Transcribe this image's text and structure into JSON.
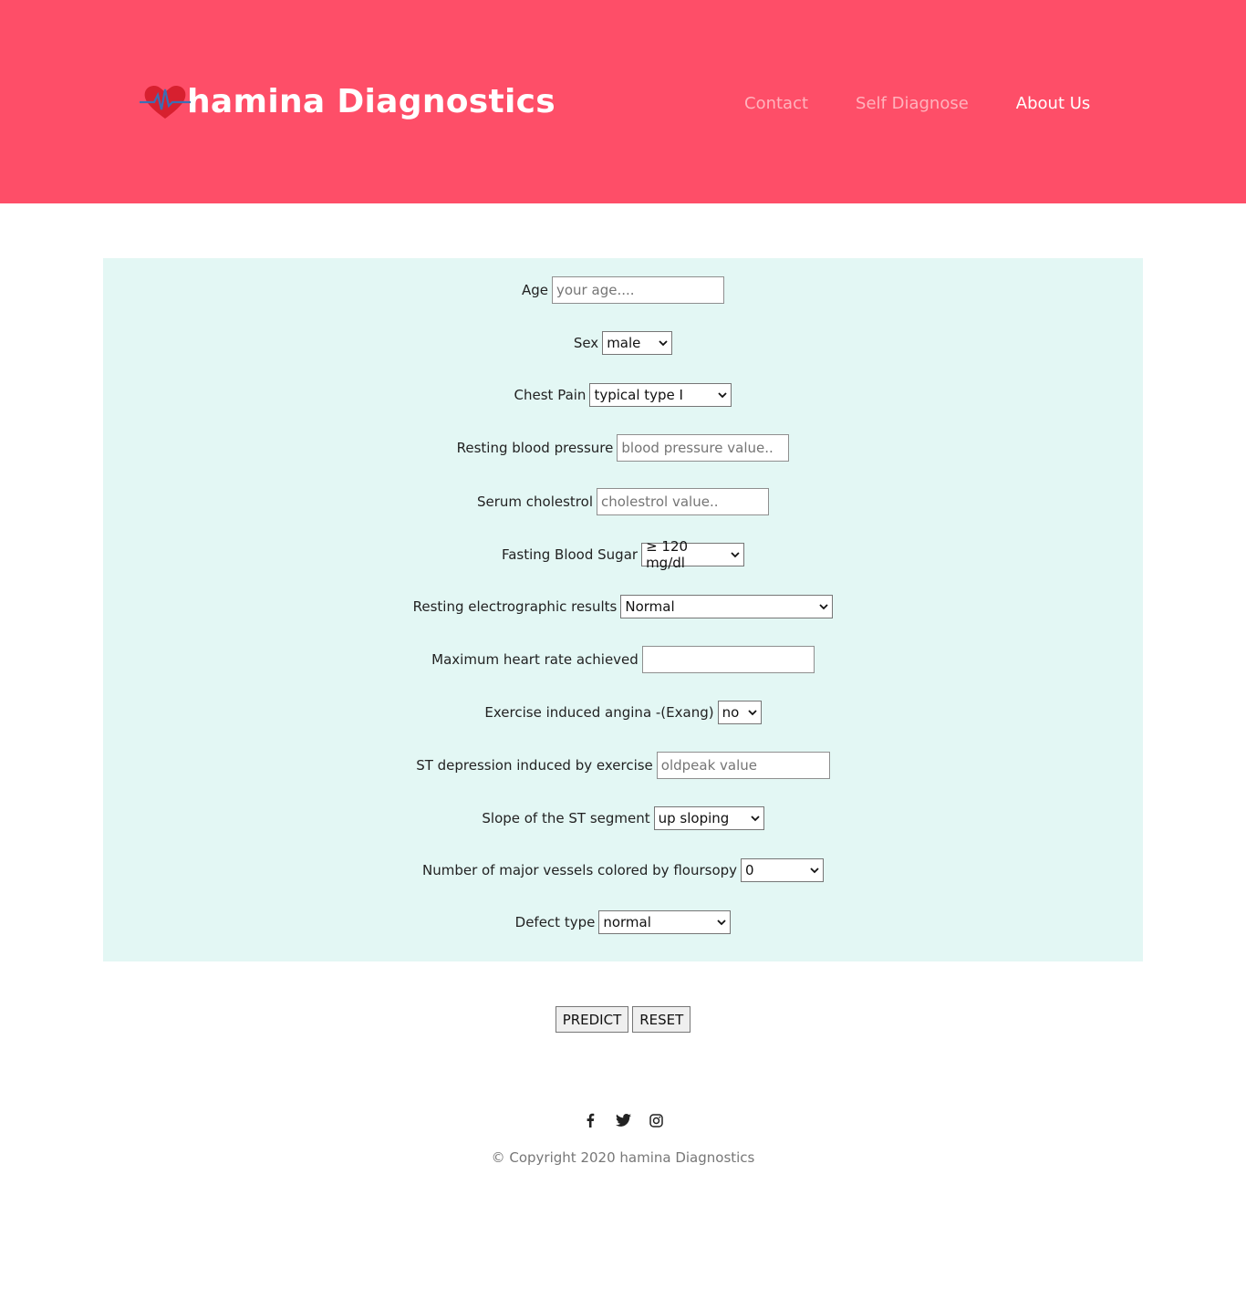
{
  "brand": {
    "name": "hamina Diagnostics",
    "accent": "#fe4e68",
    "panel_bg": "#e3f7f4"
  },
  "nav": {
    "contact": "Contact",
    "self_diagnose": "Self Diagnose",
    "about": "About Us"
  },
  "form": {
    "age": {
      "label": "Age",
      "placeholder": "your age...."
    },
    "sex": {
      "label": "Sex",
      "selected": "male"
    },
    "chest_pain": {
      "label": "Chest Pain",
      "selected": "typical type I"
    },
    "resting_bp": {
      "label": "Resting blood pressure",
      "placeholder": "blood pressure value.."
    },
    "serum_chol": {
      "label": "Serum cholestrol",
      "placeholder": "cholestrol value.."
    },
    "fbs": {
      "label": "Fasting Blood Sugar",
      "selected": "≥ 120 mg/dl"
    },
    "restecg": {
      "label": "Resting electrographic results",
      "selected": "Normal"
    },
    "thalach": {
      "label": "Maximum heart rate achieved",
      "placeholder": ""
    },
    "exang": {
      "label": "Exercise induced angina -(Exang)",
      "selected": "no"
    },
    "oldpeak": {
      "label": "ST depression induced by exercise",
      "placeholder": "oldpeak value"
    },
    "slope": {
      "label": "Slope of the ST segment",
      "selected": "up sloping"
    },
    "ca": {
      "label": "Number of major vessels colored by floursopy",
      "selected": "0"
    },
    "thal": {
      "label": "Defect type",
      "selected": "normal"
    }
  },
  "buttons": {
    "predict": "PREDICT",
    "reset": "RESET"
  },
  "footer": {
    "icons": [
      "facebook-icon",
      "twitter-icon",
      "instagram-icon"
    ],
    "copyright": "© Copyright 2020 hamina Diagnostics"
  }
}
